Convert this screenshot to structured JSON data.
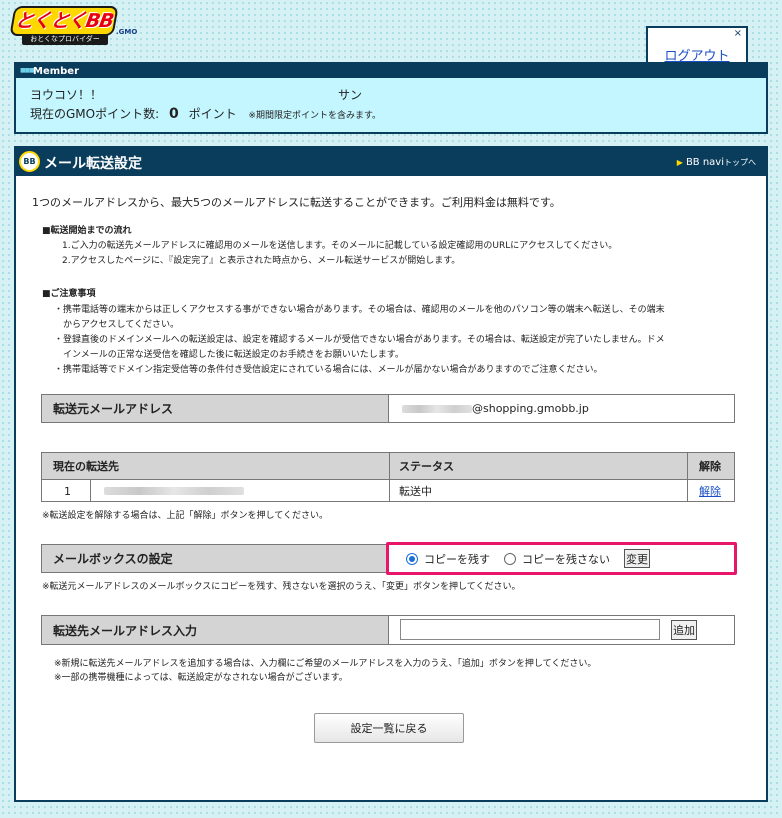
{
  "logo": {
    "text": "とくとくBB",
    "sub": "おとくなプロバイダー",
    "gmo": ".GMO"
  },
  "logout": {
    "close": "×",
    "label": "ログアウト"
  },
  "member": {
    "header": "Member",
    "greeting": "ヨウコソ！！",
    "san": "サン",
    "points_label": "現在のGMOポイント数:",
    "points_value": "0",
    "points_unit": "ポイント",
    "points_note": "※期間限定ポイントを含みます。"
  },
  "main": {
    "title": "メール転送設定",
    "icon_label": "BB",
    "nav_link_main": "BB navi",
    "nav_link_small": "トップへ",
    "intro": "1つのメールアドレスから、最大5つのメールアドレスに転送することができます。ご利用料金は無料です。",
    "flow_title": "■転送開始までの流れ",
    "flow_lines": [
      "1.ご入力の転送先メールアドレスに確認用のメールを送信します。そのメールに記載している設定確認用のURLにアクセスしてください。",
      "2.アクセスしたページに、『設定完了』と表示された時点から、メール転送サービスが開始します。"
    ],
    "caution_title": "■ご注意事項",
    "caution_lines": [
      "・携帯電話等の端末からは正しくアクセスする事ができない場合があります。その場合は、確認用のメールを他のパソコン等の端末へ転送し、その端末",
      "　からアクセスしてください。",
      "・登録直後のドメインメールへの転送設定は、設定を確認するメールが受信できない場合があります。その場合は、転送設定が完了いたしません。ドメ",
      "　インメールの正常な送受信を確認した後に転送設定のお手続きをお願いいたします。",
      "・携帯電話等でドメイン指定受信等の条件付き受信設定にされている場合には、メールが届かない場合がありますのでご注意ください。"
    ]
  },
  "source": {
    "label": "転送元メールアドレス",
    "address_domain": "@shopping.gmobb.jp"
  },
  "forward_table": {
    "headers": {
      "dest": "現在の転送先",
      "status": "ステータス",
      "release": "解除"
    },
    "rows": [
      {
        "no": "1",
        "status": "転送中",
        "action": "解除"
      }
    ],
    "note": "※転送設定を解除する場合は、上記「解除」ボタンを押してください。"
  },
  "mailbox": {
    "label": "メールボックスの設定",
    "option_keep": "コピーを残す",
    "option_nokeep": "コピーを残さない",
    "change_button": "変更",
    "note": "※転送元メールアドレスのメールボックスにコピーを残す、残さないを選択のうえ、「変更」ボタンを押してください。"
  },
  "add_dest": {
    "label": "転送先メールアドレス入力",
    "input_value": "",
    "add_button": "追加",
    "note1": "※新規に転送先メールアドレスを追加する場合は、入力欄にご希望のメールアドレスを入力のうえ、「追加」ボタンを押してください。",
    "note2": "※一部の携帯機種によっては、転送設定がなされない場合がございます。"
  },
  "back_button": "設定一覧に戻る",
  "colors": {
    "navy": "#0a3d5c",
    "highlight": "#e8156b",
    "link": "#1a4fc4",
    "member_bg": "#c4f6ff"
  }
}
